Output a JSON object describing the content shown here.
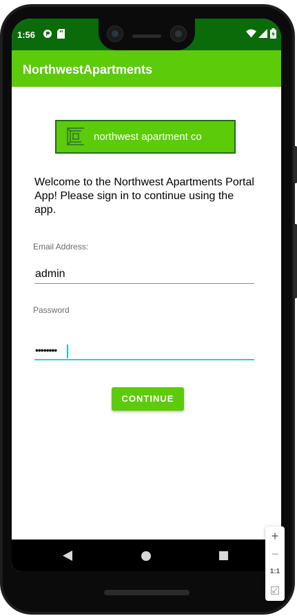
{
  "status_bar": {
    "time": "1:56",
    "left_icons": [
      "notification-circle-icon",
      "sd-card-icon"
    ],
    "right_icons": [
      "wifi-icon",
      "signal-icon",
      "battery-icon"
    ]
  },
  "app_bar": {
    "title": "NorthwestApartments"
  },
  "logo": {
    "text": "northwest apartment co",
    "icon": "building-logo-icon"
  },
  "welcome_message": "Welcome to the Northwest Apartments Portal App! Please sign in to continue using the app.",
  "form": {
    "email_label": "Email Address:",
    "email_value": "admin",
    "password_label": "Password",
    "password_value": "••••••••",
    "continue_label": "CONTINUE"
  },
  "nav_bar": {
    "buttons": [
      "back-icon",
      "home-icon",
      "recents-icon"
    ]
  },
  "zoom_controls": {
    "zoom_in": "+",
    "zoom_out": "−",
    "actual_size": "1:1",
    "fit_icon": "fit-screen-icon"
  },
  "colors": {
    "status_bar": "#0a6b0a",
    "app_bar": "#5ccb0a",
    "accent": "#2bd2c8",
    "logo_border": "#1f6b1f"
  }
}
